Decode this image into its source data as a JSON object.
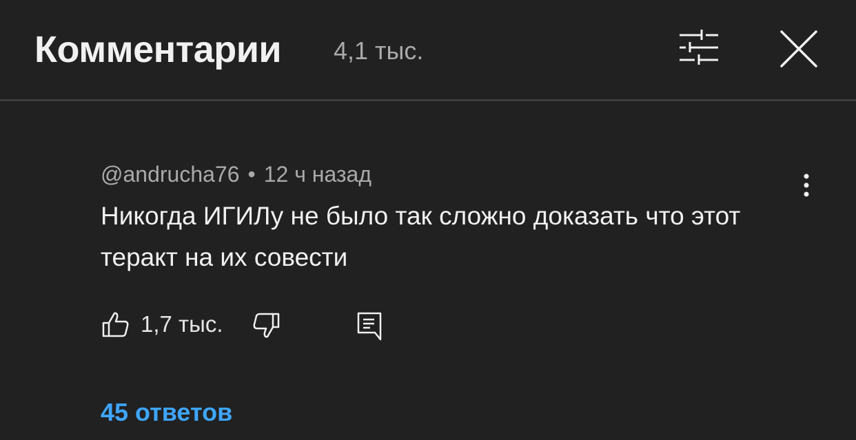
{
  "header": {
    "title": "Комментарии",
    "count": "4,1 тыс.",
    "filter_icon": "sliders-icon",
    "close_icon": "close-icon"
  },
  "comment": {
    "author": "@andrucha76",
    "separator": "•",
    "time": "12 ч назад",
    "text": "Никогда ИГИЛу не было так сложно доказать что этот теракт на их совести",
    "like_count": "1,7 тыс.",
    "replies_label": "45 ответов",
    "more_icon": "more-vert-icon",
    "like_icon": "thumb-up-icon",
    "dislike_icon": "thumb-down-icon",
    "reply_icon": "reply-icon"
  },
  "colors": {
    "background": "#212121",
    "text": "#f1f1f1",
    "secondary_text": "#aaaaaa",
    "link": "#3ea6ff",
    "divider": "#3d3d3d"
  }
}
